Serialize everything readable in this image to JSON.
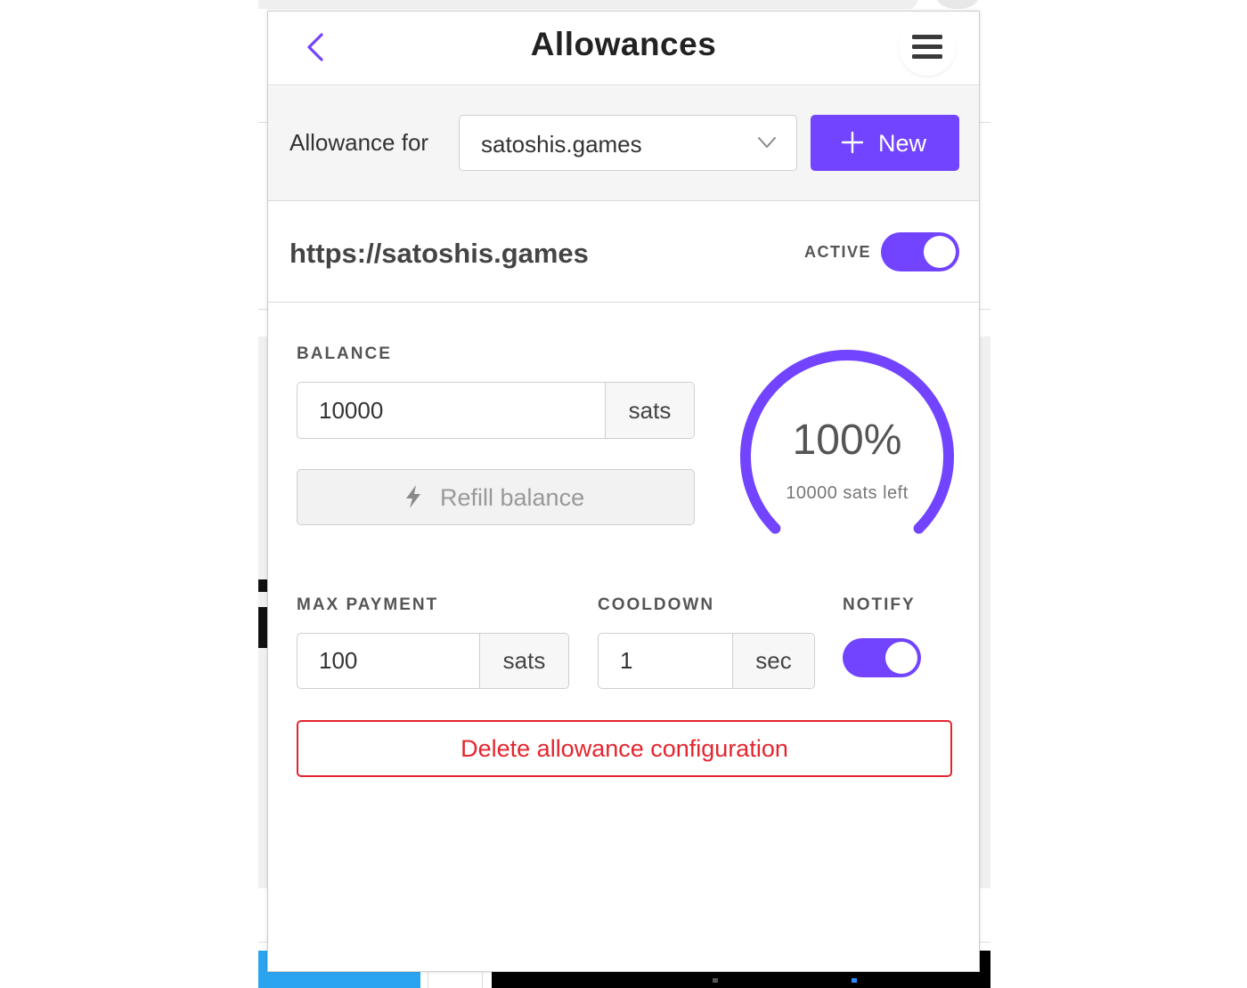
{
  "header": {
    "title": "Allowances"
  },
  "selector": {
    "label": "Allowance for",
    "selected": "satoshis.games",
    "new_button_label": "New"
  },
  "allowance": {
    "host_url": "https://satoshis.games",
    "active_label": "ACTIVE",
    "active": true
  },
  "balance": {
    "label": "BALANCE",
    "value": "10000",
    "unit": "sats",
    "refill_label": "Refill balance",
    "gauge_percent_text": "100%",
    "gauge_fraction": 1.0,
    "gauge_sub_text": "10000 sats left"
  },
  "max_payment": {
    "label": "MAX PAYMENT",
    "value": "100",
    "unit": "sats"
  },
  "cooldown": {
    "label": "COOLDOWN",
    "value": "1",
    "unit": "sec"
  },
  "notify": {
    "label": "NOTIFY",
    "enabled": true
  },
  "delete_button_label": "Delete allowance configuration",
  "colors": {
    "accent": "#7244ff",
    "danger": "#e4252e"
  },
  "icons": {
    "back": "chevron-left-icon",
    "menu": "hamburger-menu-icon",
    "select": "chevron-down-icon",
    "new": "plus-icon",
    "refill": "lightning-bolt-icon"
  }
}
